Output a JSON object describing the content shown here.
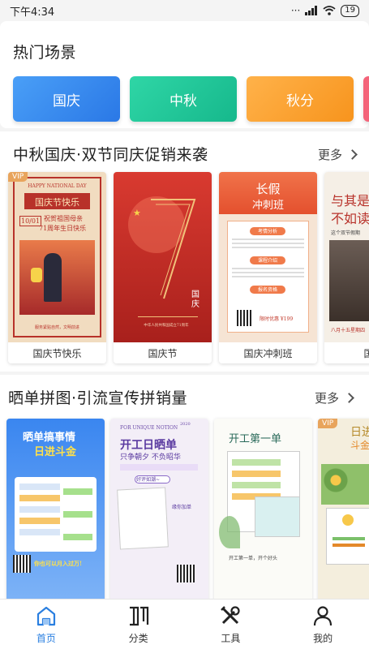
{
  "status": {
    "time": "下午4:34",
    "battery": "19"
  },
  "hot": {
    "title": "热门场景",
    "scenes": [
      {
        "label": "国庆"
      },
      {
        "label": "中秋"
      },
      {
        "label": "秋分"
      }
    ]
  },
  "section1": {
    "title": "中秋国庆·双节同庆促销来袭",
    "more": "更多",
    "cards": [
      {
        "caption": "国庆节快乐",
        "vip": "VIP",
        "t1": "HAPPY NATIONAL DAY",
        "t2": "国庆节快乐",
        "t3": "10/01",
        "t4": "祝贺祖国母亲",
        "t5": "71周年生日快乐",
        "t6": "服务紧贴自然，文明前进"
      },
      {
        "caption": "国庆节",
        "t1": "国庆",
        "t2": "中华人民共和国成立71周年"
      },
      {
        "caption": "国庆冲刺班",
        "t1": "长假",
        "t2": "冲刺班",
        "t3": "考情分析",
        "t4": "课程介绍",
        "t5": "报名资格",
        "t6": "限时优惠 ¥199"
      },
      {
        "caption": "国庆",
        "t1": "与其是",
        "t2": "不如读",
        "t3": "这个双节假期",
        "t4": "八月十五星期四"
      }
    ]
  },
  "section2": {
    "title": "晒单拼图·引流宣传拼销量",
    "more": "更多",
    "cards": [
      {
        "t1": "晒单搞事情",
        "t2": "日进斗金",
        "t3": "你也可以月入过万!"
      },
      {
        "t1": "FOR UNIQUE NOTION",
        "t2": "开工日晒单",
        "t3": "只争朝夕  不负昭华",
        "t4": "好评如潮~",
        "t5": "缘你加单",
        "t6": "2020"
      },
      {
        "t1": "开工第一单",
        "t2": "开工第一单，开个好头"
      },
      {
        "t1": "日进",
        "t2": "斗金"
      }
    ]
  },
  "tabs": [
    {
      "label": "首页",
      "icon": "home-icon"
    },
    {
      "label": "分类",
      "icon": "category-icon"
    },
    {
      "label": "工具",
      "icon": "tools-icon"
    },
    {
      "label": "我的",
      "icon": "user-icon"
    }
  ],
  "colors": {
    "accent": "#2a7fe0",
    "national_red": "#c23a2b"
  }
}
